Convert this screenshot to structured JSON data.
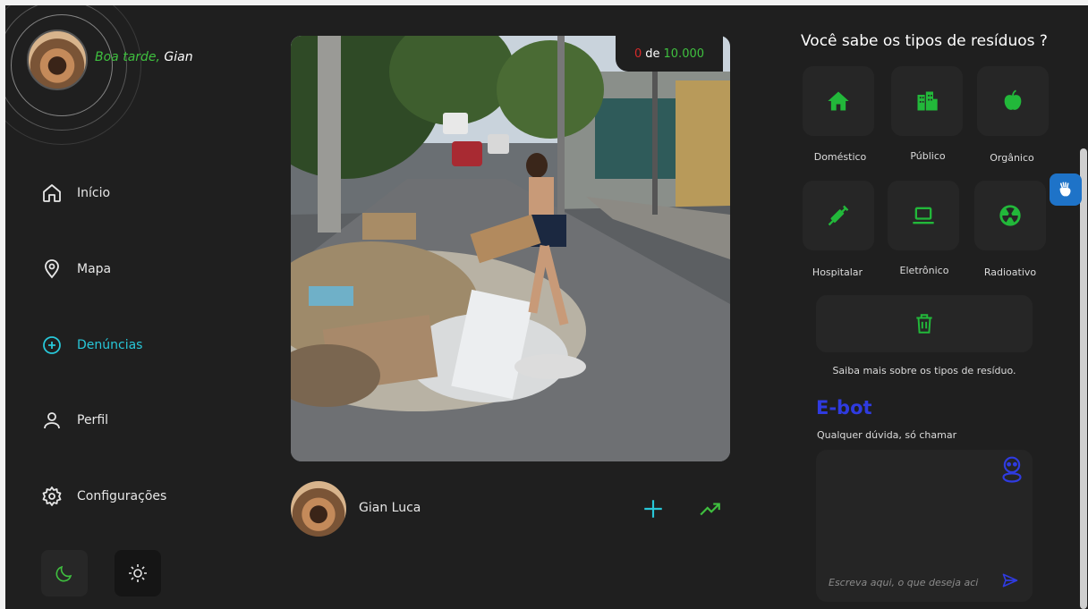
{
  "greeting": {
    "part1": "Boa tarde,",
    "part2": " Gian"
  },
  "nav": {
    "inicio": "Início",
    "mapa": "Mapa",
    "denuncias": "Denúncias",
    "perfil": "Perfil",
    "config": "Configurações"
  },
  "theme": {
    "dark_icon": "moon-icon",
    "light_icon": "sun-icon"
  },
  "counter": {
    "current": "0",
    "sep": "de",
    "max": "10.000"
  },
  "post": {
    "user_name": "Gian Luca",
    "add_icon": "plus-icon",
    "trend_icon": "trending-up-icon"
  },
  "waste": {
    "title": "Você sabe os tipos de resíduos ?",
    "types": {
      "domestico": "Doméstico",
      "publico": "Público",
      "organico": "Orgânico",
      "hospitalar": "Hospitalar",
      "eletronico": "Eletrônico",
      "radioativo": "Radioativo"
    },
    "learn_more": "Saiba mais sobre os tipos de resíduo."
  },
  "ebot": {
    "title": "E-bot",
    "subtitle": "Qualquer dúvida, só chamar",
    "placeholder": "Escreva aqui, o que deseja aci"
  },
  "colors": {
    "background": "#1f1f1f",
    "tile": "#262626",
    "green": "#3fc03f",
    "cyan": "#28c7d8",
    "blue": "#2f3be0",
    "red": "#d62a2a"
  }
}
